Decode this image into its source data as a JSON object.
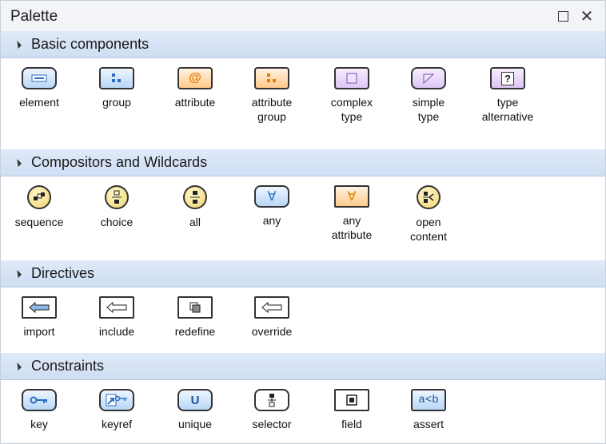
{
  "window": {
    "title": "Palette"
  },
  "sections": [
    {
      "label": "Basic components"
    },
    {
      "label": "Compositors and Wildcards"
    },
    {
      "label": "Directives"
    },
    {
      "label": "Constraints"
    }
  ],
  "basic": [
    {
      "label": "element",
      "icon": "element-icon"
    },
    {
      "label": "group",
      "icon": "group-icon"
    },
    {
      "label": "attribute",
      "icon": "attribute-icon"
    },
    {
      "label": "attribute\ngroup",
      "icon": "attribute-group-icon"
    },
    {
      "label": "complex\ntype",
      "icon": "complex-type-icon"
    },
    {
      "label": "simple\ntype",
      "icon": "simple-type-icon"
    },
    {
      "label": "type\nalternative",
      "icon": "type-alternative-icon"
    }
  ],
  "compositors": [
    {
      "label": "sequence",
      "icon": "sequence-icon"
    },
    {
      "label": "choice",
      "icon": "choice-icon"
    },
    {
      "label": "all",
      "icon": "all-icon"
    },
    {
      "label": "any",
      "icon": "any-icon"
    },
    {
      "label": "any\nattribute",
      "icon": "any-attribute-icon"
    },
    {
      "label": "open\ncontent",
      "icon": "open-content-icon"
    }
  ],
  "directives": [
    {
      "label": "import",
      "icon": "import-icon"
    },
    {
      "label": "include",
      "icon": "include-icon"
    },
    {
      "label": "redefine",
      "icon": "redefine-icon"
    },
    {
      "label": "override",
      "icon": "override-icon"
    }
  ],
  "constraints": [
    {
      "label": "key",
      "icon": "key-icon"
    },
    {
      "label": "keyref",
      "icon": "keyref-icon"
    },
    {
      "label": "unique",
      "icon": "unique-icon"
    },
    {
      "label": "selector",
      "icon": "selector-icon"
    },
    {
      "label": "field",
      "icon": "field-icon"
    },
    {
      "label": "assert",
      "icon": "assert-icon"
    }
  ],
  "icon_text": {
    "unique": "U",
    "assert": "a<b",
    "type_alternative": "?",
    "at": "@",
    "any": "∀"
  }
}
